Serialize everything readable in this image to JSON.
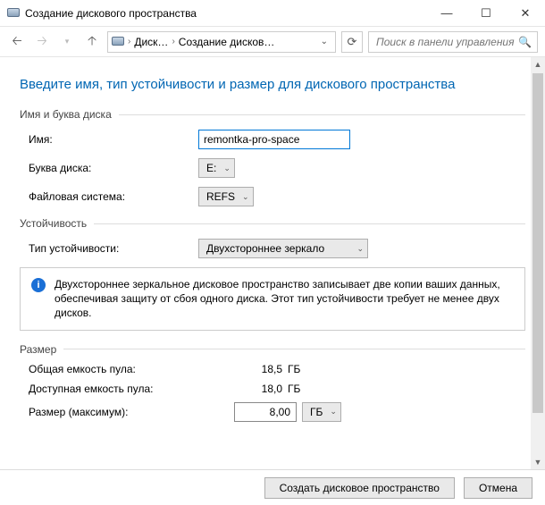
{
  "window": {
    "title": "Создание дискового пространства"
  },
  "breadcrumbs": {
    "item1": "Диск…",
    "item2": "Создание дисков…"
  },
  "search": {
    "placeholder": "Поиск в панели управления"
  },
  "page_title": "Введите имя, тип устойчивости и размер для дискового пространства",
  "sections": {
    "name_letter": "Имя и буква диска",
    "resiliency": "Устойчивость",
    "size": "Размер"
  },
  "labels": {
    "name": "Имя:",
    "drive_letter": "Буква диска:",
    "filesystem": "Файловая система:",
    "resiliency_type": "Тип устойчивости:",
    "total_capacity": "Общая емкость пула:",
    "available_capacity": "Доступная емкость пула:",
    "size_max": "Размер (максимум):"
  },
  "values": {
    "name": "remontka-pro-space",
    "drive_letter": "E:",
    "filesystem": "REFS",
    "resiliency_type": "Двухстороннее зеркало",
    "total_capacity": "18,5",
    "total_unit": "ГБ",
    "available_capacity": "18,0",
    "available_unit": "ГБ",
    "size": "8,00",
    "size_unit": "ГБ"
  },
  "info_text": "Двухстороннее зеркальное дисковое пространство записывает две копии ваших данных, обеспечивая защиту от сбоя одного диска. Этот тип устойчивости требует не менее двух дисков.",
  "buttons": {
    "create": "Создать дисковое пространство",
    "cancel": "Отмена"
  }
}
